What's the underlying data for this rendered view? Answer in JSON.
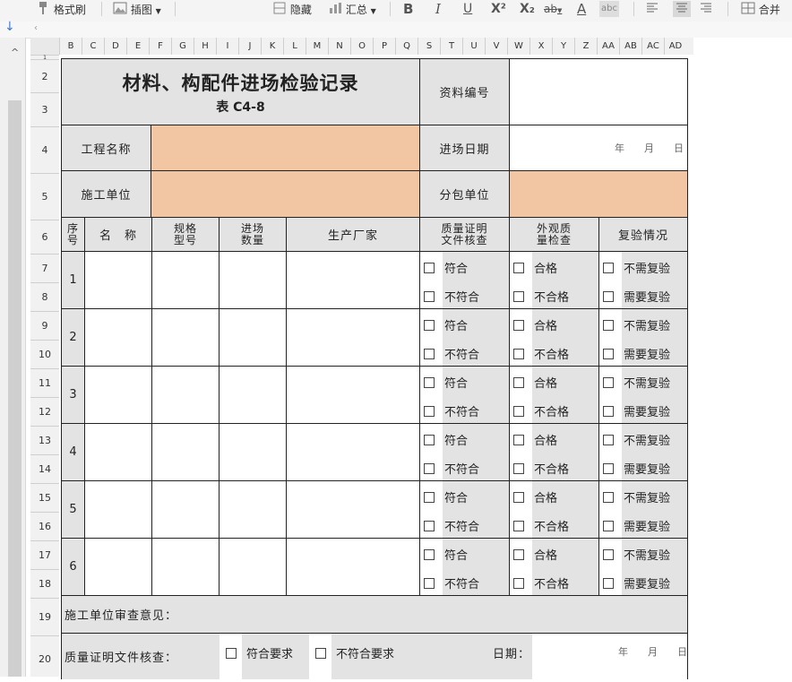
{
  "toolbar": {
    "format_painter": "格式刷",
    "insert_picture": "插图",
    "hide": "隐藏",
    "summary": "汇总",
    "bold": "B",
    "italic": "I",
    "underline": "U",
    "superscript": "X²",
    "subscript": "X₂",
    "strikethrough": "ab",
    "font_color": "A",
    "char_border": "abc",
    "merge": "合并"
  },
  "columns": [
    "B",
    "C",
    "D",
    "E",
    "F",
    "G",
    "H",
    "I",
    "J",
    "K",
    "L",
    "M",
    "N",
    "O",
    "P",
    "Q",
    "S",
    "T",
    "U",
    "V",
    "W",
    "X",
    "Y",
    "Z",
    "AA",
    "AB",
    "AC",
    "AD"
  ],
  "rows": [
    "1",
    "2",
    "3",
    "4",
    "5",
    "6",
    "7",
    "8",
    "9",
    "10",
    "11",
    "12",
    "13",
    "14",
    "15",
    "16",
    "17",
    "18",
    "19",
    "20"
  ],
  "form": {
    "title": "材料、构配件进场检验记录",
    "subtitle": "表 C4-8",
    "record_no_label": "资料编号",
    "project_name_label": "工程名称",
    "entry_date_label": "进场日期",
    "date_placeholder": "年　　月　　日",
    "constructor_label": "施工单位",
    "subcontractor_label": "分包单位",
    "headers": {
      "seq": "序号",
      "name": "名　称",
      "spec": "规格型号",
      "qty": "进场数量",
      "maker": "生产厂家",
      "quality_doc": "质量证明文件核查",
      "appearance": "外观质量检查",
      "retest": "复验情况"
    },
    "options": {
      "conform": "符合",
      "nonconform": "不符合",
      "pass": "合格",
      "fail": "不合格",
      "no_retest": "不需复验",
      "need_retest": "需要复验"
    },
    "items": [
      "1",
      "2",
      "3",
      "4",
      "5",
      "6"
    ],
    "review_label": "施工单位审查意见：",
    "doc_check_label": "质量证明文件核查：",
    "meets_req": "符合要求",
    "not_meets_req": "不符合要求",
    "date_label": "日期："
  }
}
